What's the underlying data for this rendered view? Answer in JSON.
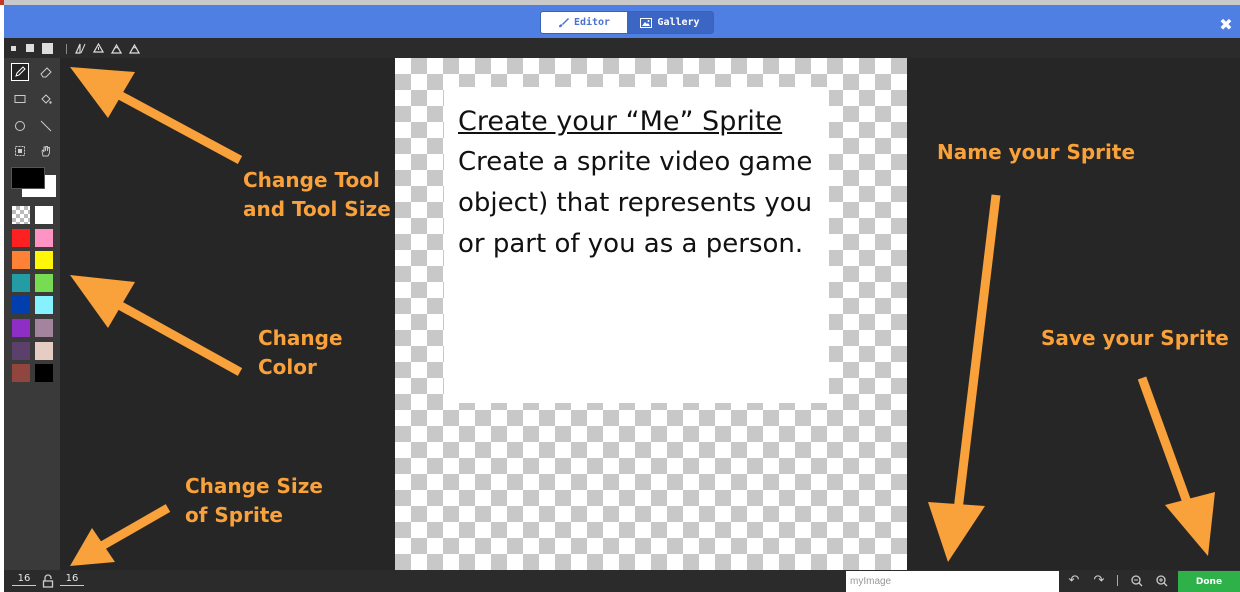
{
  "header": {
    "tabs": [
      {
        "label": "Editor",
        "icon": "brush-icon",
        "active": true
      },
      {
        "label": "Gallery",
        "icon": "image-icon",
        "active": false
      }
    ],
    "close_icon": "close-icon"
  },
  "size_toolbar": {
    "sizes": [
      "small",
      "medium",
      "large"
    ],
    "flip_tools": [
      "flip-horizontal-icon",
      "flip-vertical-icon",
      "rotate-left-icon",
      "rotate-right-icon"
    ]
  },
  "tools": [
    {
      "name": "pencil",
      "icon": "pencil-icon",
      "selected": true
    },
    {
      "name": "eraser",
      "icon": "eraser-icon",
      "selected": false
    },
    {
      "name": "rectangle",
      "icon": "rectangle-icon",
      "selected": false
    },
    {
      "name": "fill",
      "icon": "fill-bucket-icon",
      "selected": false
    },
    {
      "name": "circle",
      "icon": "circle-icon",
      "selected": false
    },
    {
      "name": "line",
      "icon": "line-icon",
      "selected": false
    },
    {
      "name": "marquee",
      "icon": "marquee-icon",
      "selected": false
    },
    {
      "name": "pan",
      "icon": "hand-icon",
      "selected": false
    }
  ],
  "colors": {
    "primary": "#000000",
    "secondary": "#ffffff",
    "palette": [
      "transparent",
      "#ffffff",
      "#ff2121",
      "#ff93c4",
      "#ff8135",
      "#fff609",
      "#249ca3",
      "#78dc52",
      "#003fad",
      "#87f2ff",
      "#8e2ec4",
      "#a4839f",
      "#5c406c",
      "#e5cdc4",
      "#91463d",
      "#000000"
    ]
  },
  "canvas_note": {
    "title": "Create your “Me” Sprite",
    "body": "Create a sprite video game object) that represents you or part of you as a person."
  },
  "annotations": {
    "tool": [
      "Change Tool",
      "and Tool Size"
    ],
    "color": [
      "Change",
      "Color"
    ],
    "size": [
      "Change Size",
      "of Sprite"
    ],
    "name": "Name your Sprite",
    "save": "Save your Sprite"
  },
  "bottom_bar": {
    "width_value": "16",
    "height_value": "16",
    "name_value": "myImage",
    "done_label": "Done",
    "icons": [
      "undo-icon",
      "redo-icon",
      "zoom-out-icon",
      "zoom-in-icon"
    ]
  },
  "accent_color": "#f9a13a"
}
